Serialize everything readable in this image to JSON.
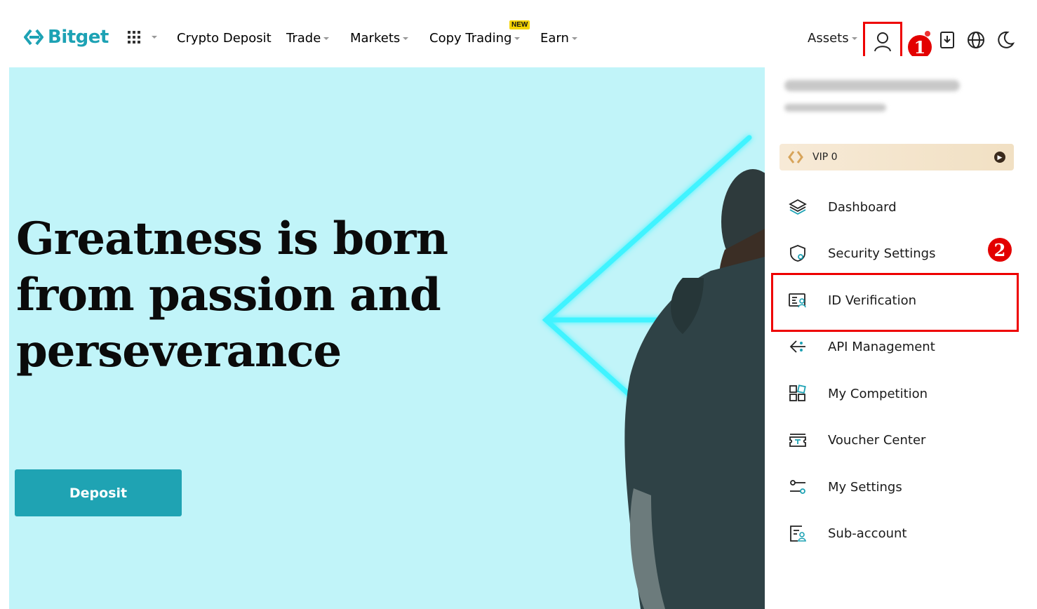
{
  "header": {
    "brand": "Bitget",
    "nav": [
      {
        "label": "Crypto Deposit"
      },
      {
        "label": "Trade"
      },
      {
        "label": "Markets"
      },
      {
        "label": "Copy Trading"
      },
      {
        "label": "Earn"
      }
    ],
    "new_badge": "NEW",
    "assets_label": "Assets"
  },
  "annotations": {
    "step1": "1",
    "step2": "2"
  },
  "hero": {
    "headline_line1": "Greatness is born",
    "headline_line2": "from passion and",
    "headline_line3": "perseverance",
    "deposit_label": "Deposit"
  },
  "account_menu": {
    "vip_label": "VIP 0",
    "items": [
      {
        "label": "Dashboard",
        "icon": "layers-icon"
      },
      {
        "label": "Security Settings",
        "icon": "shield-icon"
      },
      {
        "label": "ID Verification",
        "icon": "id-card-icon"
      },
      {
        "label": "API Management",
        "icon": "api-icon"
      },
      {
        "label": "My Competition",
        "icon": "grid-icon"
      },
      {
        "label": "Voucher Center",
        "icon": "voucher-icon"
      },
      {
        "label": "My Settings",
        "icon": "sliders-icon"
      },
      {
        "label": "Sub-account",
        "icon": "sub-account-icon"
      }
    ]
  },
  "colors": {
    "brand": "#1da2b4",
    "hero_bg": "#c1f4f9",
    "highlight": "#e30000"
  }
}
